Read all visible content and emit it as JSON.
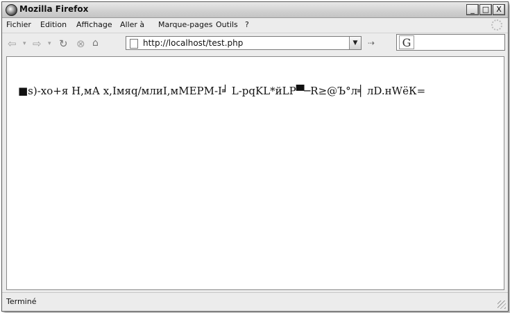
{
  "window": {
    "title": "Mozilla Firefox",
    "buttons": {
      "minimize": "_",
      "maximize": "□",
      "close": "X"
    }
  },
  "menubar": {
    "items": [
      "Fichier",
      "Edition",
      "Affichage",
      "Aller à",
      "Marque-pages",
      "Outils",
      "?"
    ]
  },
  "navbar": {
    "back_icon": "back-arrow-icon",
    "forward_icon": "forward-arrow-icon",
    "reload_icon": "reload-icon",
    "stop_icon": "stop-icon",
    "url": "http://localhost/test.php",
    "search_engine_glyph": "G"
  },
  "content": {
    "text": "■s)-хо+я Н,мА х,Iмяq/млиI,мМЕРМ-I╛ L-pqKL*йLP▀─R≥@Ъ°л╡ лD.нWёК="
  },
  "status": {
    "text": "Terminé"
  }
}
